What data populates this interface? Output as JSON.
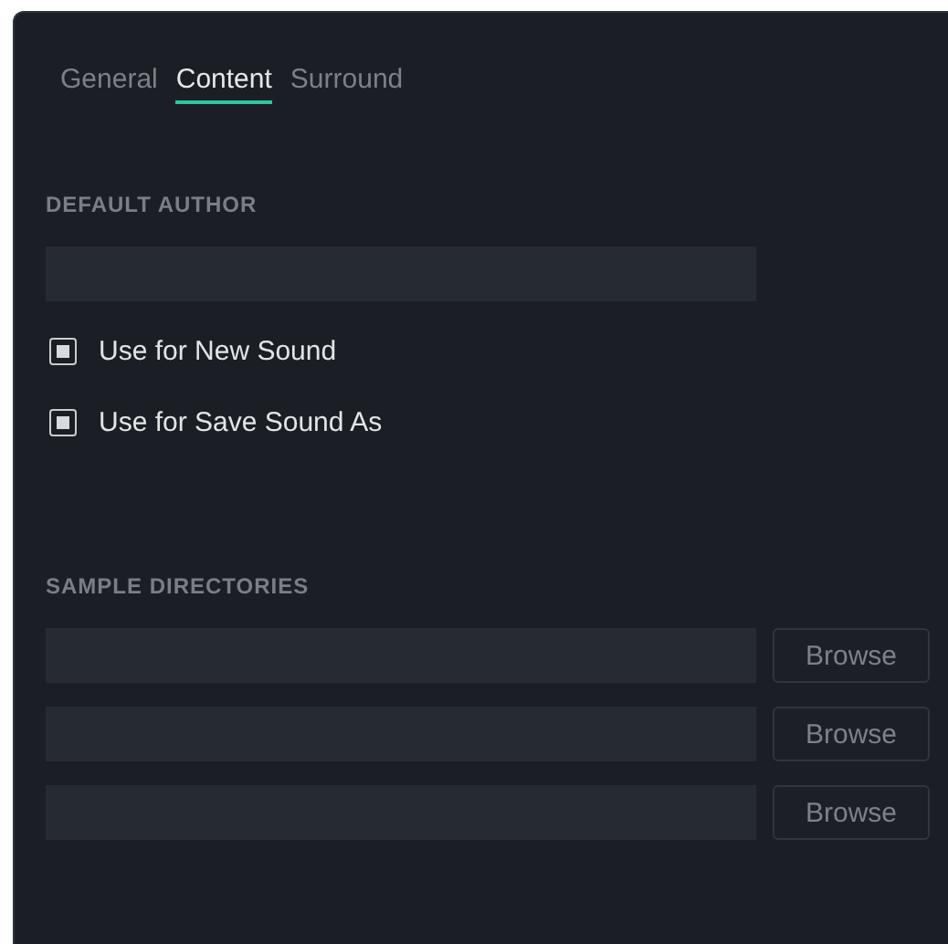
{
  "tabs": [
    {
      "label": "General",
      "selected": false
    },
    {
      "label": "Content",
      "selected": true
    },
    {
      "label": "Surround",
      "selected": false
    }
  ],
  "default_author": {
    "heading": "DEFAULT AUTHOR",
    "options": [
      {
        "label": "Use for New Sound",
        "checked": true
      },
      {
        "label": "Use for Save Sound As",
        "checked": true
      }
    ]
  },
  "sample_directories": {
    "heading": "SAMPLE DIRECTORIES",
    "rows": [
      {
        "button": "Browse"
      },
      {
        "button": "Browse"
      },
      {
        "button": "Browse"
      }
    ]
  }
}
